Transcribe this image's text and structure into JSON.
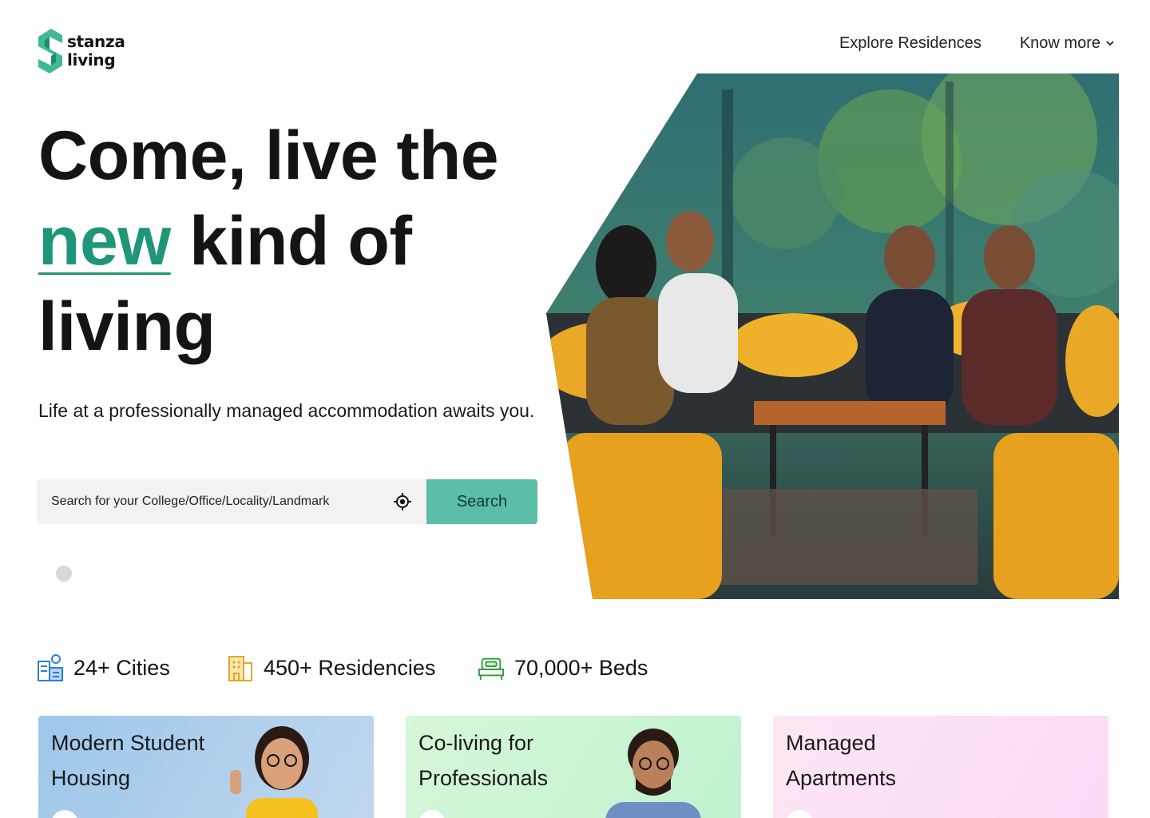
{
  "brand": {
    "line1": "stanza",
    "line2": "living",
    "accent_color": "#1e9679"
  },
  "nav": {
    "explore": "Explore Residences",
    "know_more": "Know more"
  },
  "hero": {
    "line1": "Come, live the",
    "accent_word": "new",
    "line2_rest": " kind of",
    "line3": "living",
    "subtitle": "Life at a professionally managed accommodation awaits you."
  },
  "search": {
    "placeholder": "Search for your College/Office/Locality/Landmark",
    "button_label": "Search",
    "button_color": "#5bbea6"
  },
  "stats": [
    {
      "icon": "city-icon",
      "label": "24+ Cities"
    },
    {
      "icon": "building-icon",
      "label": "450+ Residencies"
    },
    {
      "icon": "bed-icon",
      "label": "70,000+ Beds"
    }
  ],
  "cards": [
    {
      "title": "Modern Student Housing"
    },
    {
      "title": "Co-living for Professionals"
    },
    {
      "title": "Managed Apartments"
    }
  ]
}
